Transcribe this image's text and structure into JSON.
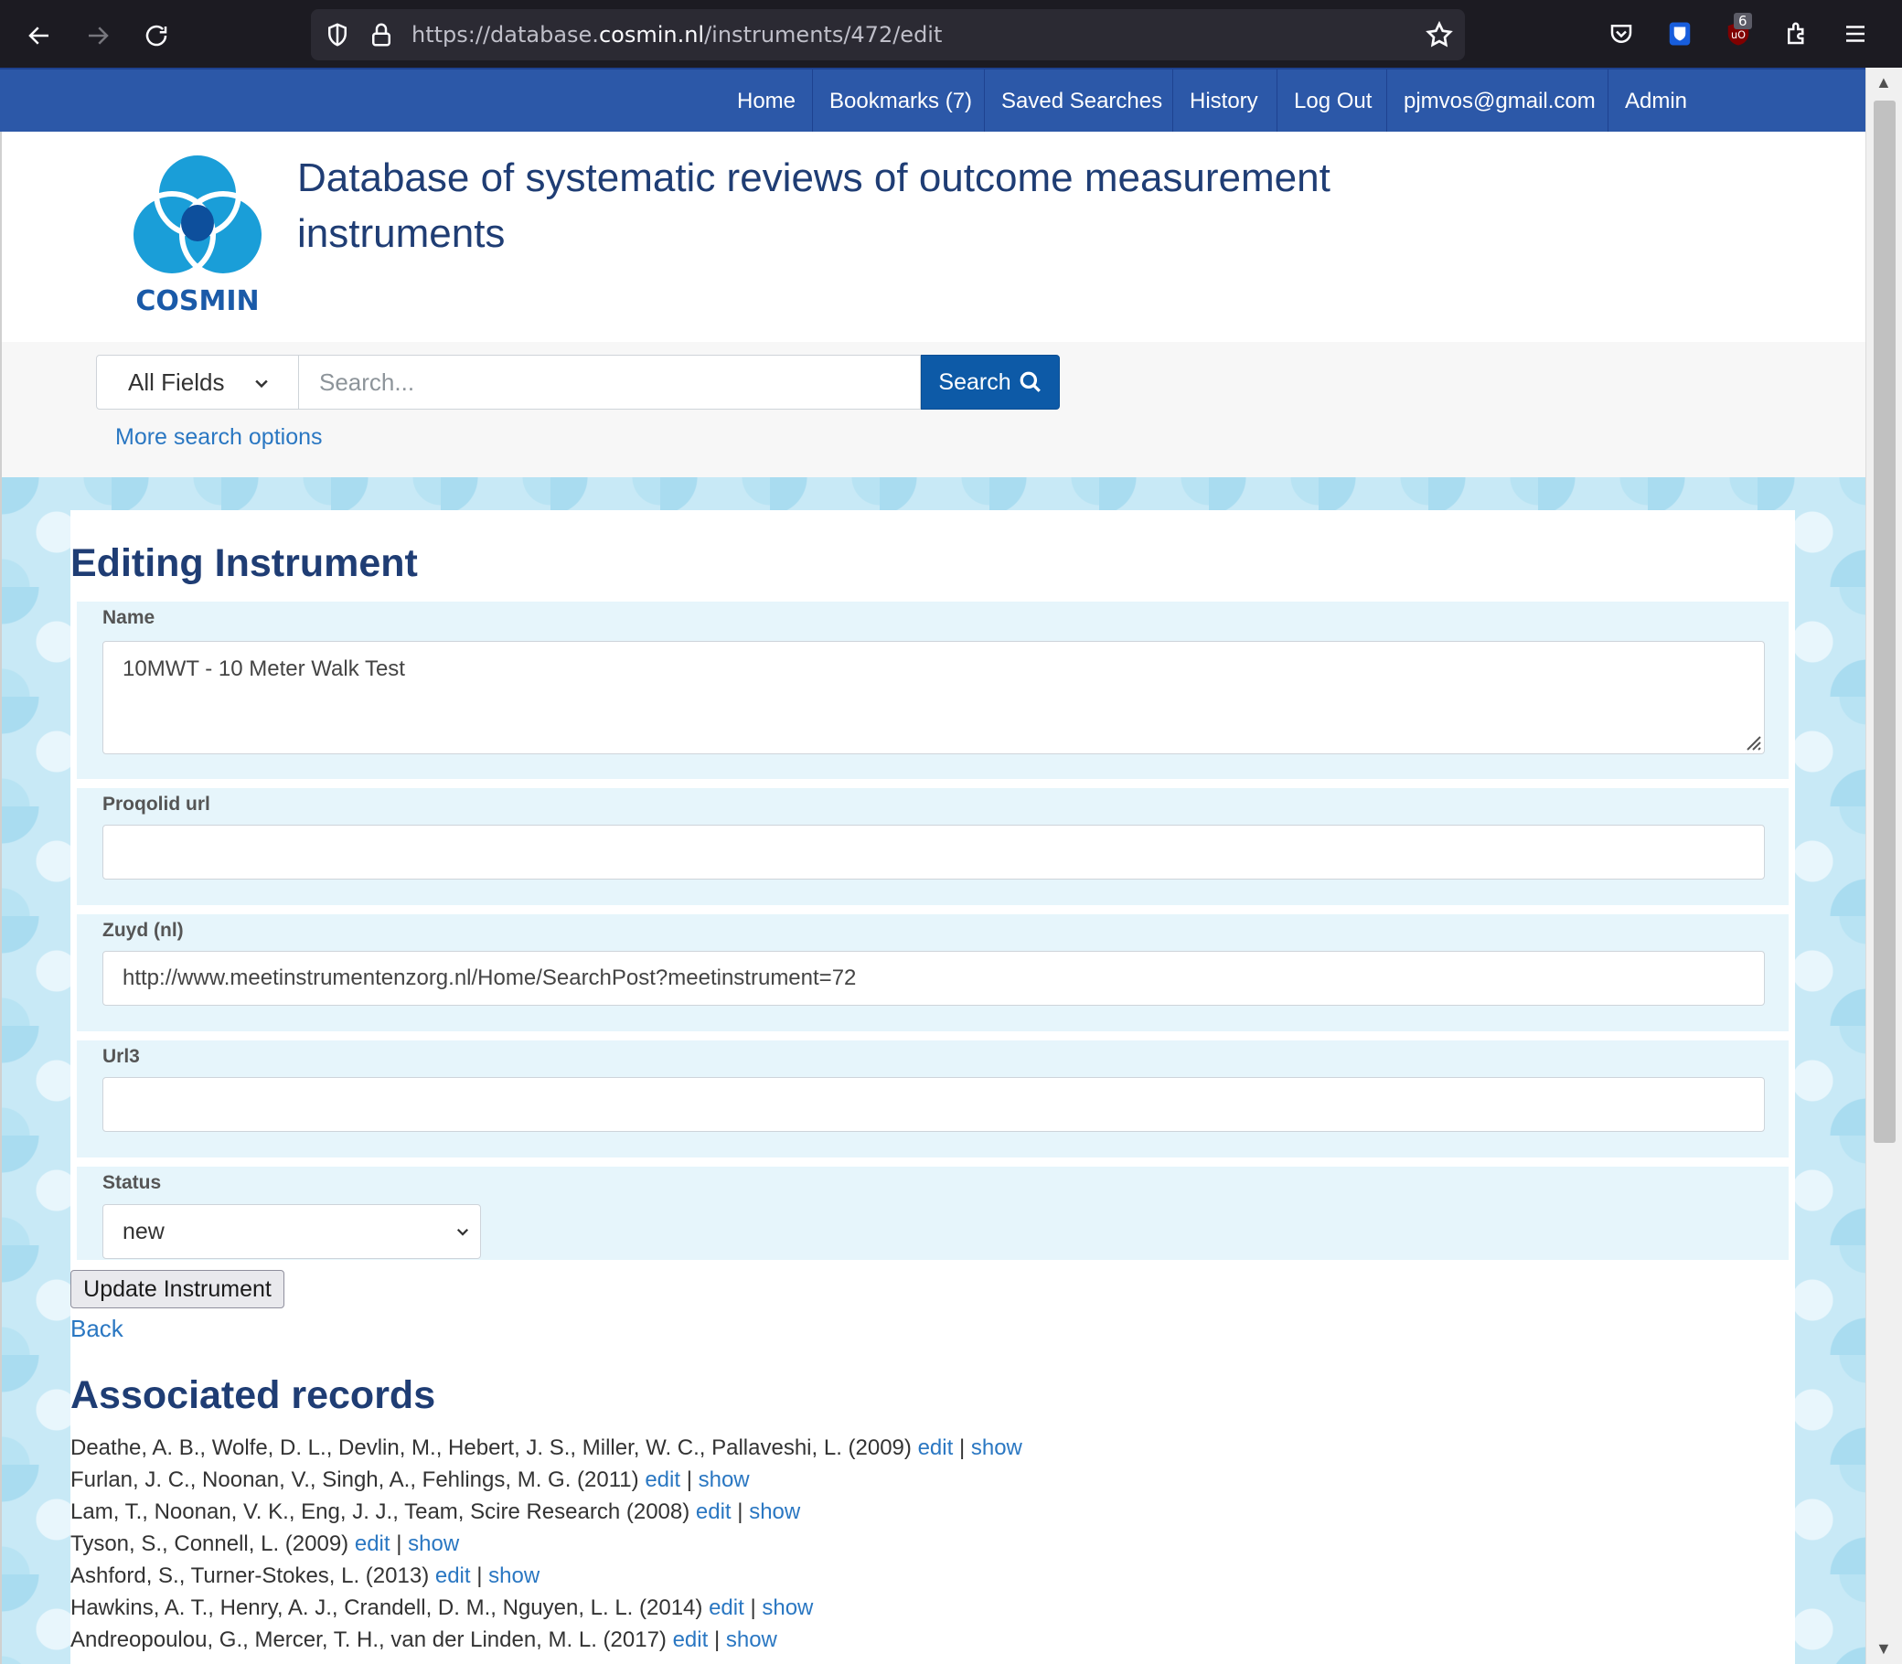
{
  "browser": {
    "url_prefix": "https://database.",
    "url_host": "cosmin.nl",
    "url_path": "/instruments/472/edit",
    "extension_badge": "6"
  },
  "site_nav": {
    "items": [
      {
        "label": "Home"
      },
      {
        "label": "Bookmarks (7)"
      },
      {
        "label": "Saved Searches"
      },
      {
        "label": "History"
      },
      {
        "label": "Log Out"
      },
      {
        "label": "pjmvos@gmail.com"
      },
      {
        "label": "Admin"
      }
    ]
  },
  "header": {
    "logo_text": "COSMIN",
    "title": "Database of systematic reviews of outcome measurement instruments"
  },
  "search": {
    "field_selected": "All Fields",
    "placeholder": "Search...",
    "button_label": "Search",
    "more_options": "More search options"
  },
  "form": {
    "heading": "Editing Instrument",
    "name_label": "Name",
    "name_value": "10MWT - 10 Meter Walk Test",
    "proqolid_label": "Proqolid url",
    "proqolid_value": "",
    "zuyd_label": "Zuyd (nl)",
    "zuyd_value": "http://www.meetinstrumentenzorg.nl/Home/SearchPost?meetinstrument=72",
    "url3_label": "Url3",
    "url3_value": "",
    "status_label": "Status",
    "status_value": "new",
    "submit_label": "Update Instrument",
    "back_label": "Back"
  },
  "associated": {
    "heading": "Associated records",
    "edit_label": "edit",
    "separator": "|",
    "show_label": "show",
    "records": [
      {
        "citation": "Deathe, A. B., Wolfe, D. L., Devlin, M., Hebert, J. S., Miller, W. C., Pallaveshi, L. (2009)"
      },
      {
        "citation": "Furlan, J. C., Noonan, V., Singh, A., Fehlings, M. G. (2011)"
      },
      {
        "citation": "Lam, T., Noonan, V. K., Eng, J. J., Team, Scire Research (2008)"
      },
      {
        "citation": "Tyson, S., Connell, L. (2009)"
      },
      {
        "citation": "Ashford, S., Turner-Stokes, L. (2013)"
      },
      {
        "citation": "Hawkins, A. T., Henry, A. J., Crandell, D. M., Nguyen, L. L. (2014)"
      },
      {
        "citation": "Andreopoulou, G., Mercer, T. H., van der Linden, M. L. (2017)"
      }
    ]
  },
  "colors": {
    "nav_bg": "#2c58a8",
    "link": "#2a77c2",
    "search_button": "#0d5aa7",
    "heading": "#1f3d74",
    "form_group_bg": "#e6f5fb"
  }
}
